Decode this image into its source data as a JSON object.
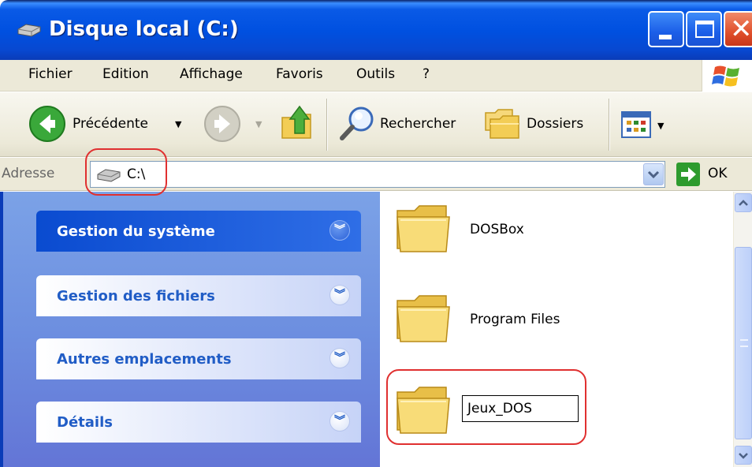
{
  "window": {
    "title": "Disque local (C:)",
    "title_icon": "hard-drive-icon",
    "controls": [
      "minimize-icon",
      "maximize-icon",
      "close-icon"
    ]
  },
  "menu": {
    "items": [
      "Fichier",
      "Edition",
      "Affichage",
      "Favoris",
      "Outils",
      "?"
    ]
  },
  "toolbar": {
    "back_label": "Précédente",
    "search_label": "Rechercher",
    "folders_label": "Dossiers"
  },
  "address": {
    "label": "Adresse",
    "value": "C:\\",
    "go_label": "OK"
  },
  "taskpane": {
    "groups": [
      {
        "title": "Gestion du système",
        "style": "special"
      },
      {
        "title": "Gestion des fichiers",
        "style": "normal"
      },
      {
        "title": "Autres emplacements",
        "style": "normal"
      },
      {
        "title": "Détails",
        "style": "normal"
      }
    ]
  },
  "files": {
    "items": [
      "DOSBox",
      "Program Files"
    ],
    "rename_value": "Jeux_DOS"
  },
  "colors": {
    "title_blue": "#0050e0",
    "pane_blue": "#6d8fe0",
    "highlight_red": "#e03030",
    "folder_yellow": "#f6d66b"
  }
}
